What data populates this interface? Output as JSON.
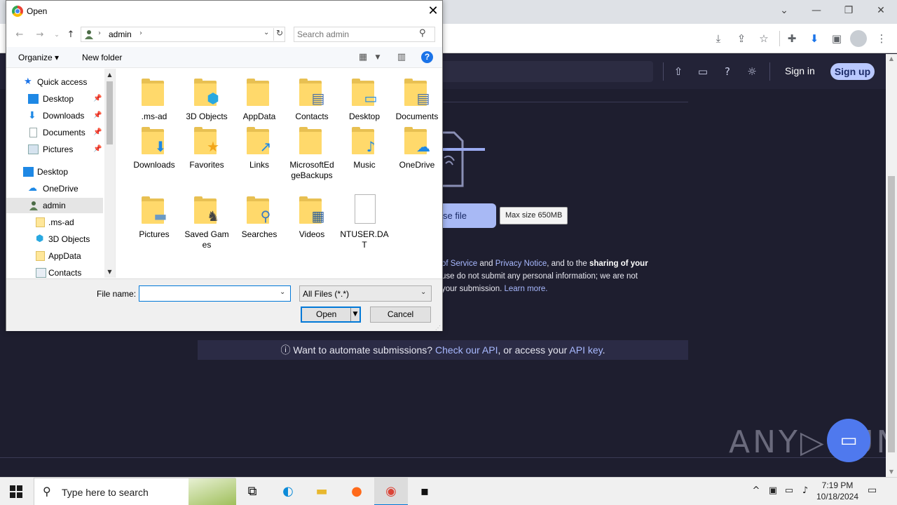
{
  "browser": {
    "window_controls": [
      "⌄",
      "—",
      "❐",
      "✕"
    ],
    "toolbar_icons": [
      "download-page-icon",
      "share-icon",
      "star-icon",
      "extensions-icon",
      "downloads-icon",
      "side-panel-icon",
      "profile-icon",
      "menu-icon"
    ]
  },
  "site": {
    "header": {
      "sign_in": "Sign in",
      "sign_up": "Sign up"
    },
    "upload": {
      "choose_file": "se file",
      "max_size": "Max size 650MB"
    },
    "terms": {
      "link1": "of Service",
      "and1": " and ",
      "link2": "Privacy Notice",
      "text1": ", and to the ",
      "bold1": "sharing of your",
      "line2": "use do not submit any personal information; we are not",
      "line3": "your submission. ",
      "link3": "Learn more."
    },
    "api": {
      "prefix": "Want to automate submissions? ",
      "link1": "Check our API",
      "middle": ", or access your ",
      "link2": "API key",
      "suffix": "."
    },
    "watermark": "ANY▷RUN"
  },
  "dialog": {
    "title": "Open",
    "breadcrumb": [
      "admin"
    ],
    "search_placeholder": "Search admin",
    "toolbar": {
      "organize": "Organize ▾",
      "new_folder": "New folder"
    },
    "nav": {
      "quick_access": "Quick access",
      "items": [
        {
          "label": "Desktop",
          "pinned": true
        },
        {
          "label": "Downloads",
          "pinned": true
        },
        {
          "label": "Documents",
          "pinned": true
        },
        {
          "label": "Pictures",
          "pinned": true
        }
      ],
      "desktop": "Desktop",
      "onedrive": "OneDrive",
      "admin": "admin",
      "sub": [
        ".ms-ad",
        "3D Objects",
        "AppData",
        "Contacts"
      ]
    },
    "files": [
      {
        "name": ".ms-ad",
        "kind": "folder",
        "overlay": ""
      },
      {
        "name": "3D Objects",
        "kind": "folder",
        "overlay": "⬢"
      },
      {
        "name": "AppData",
        "kind": "folder",
        "overlay": ""
      },
      {
        "name": "Contacts",
        "kind": "folder",
        "overlay": "▤"
      },
      {
        "name": "Desktop",
        "kind": "folder",
        "overlay": "▭"
      },
      {
        "name": "Documents",
        "kind": "folder",
        "overlay": "▤"
      },
      {
        "name": "Downloads",
        "kind": "folder",
        "overlay": "⬇"
      },
      {
        "name": "Favorites",
        "kind": "folder",
        "overlay": "★"
      },
      {
        "name": "Links",
        "kind": "folder",
        "overlay": "↗"
      },
      {
        "name": "MicrosoftEdgeBackups",
        "kind": "folder",
        "overlay": ""
      },
      {
        "name": "Music",
        "kind": "folder",
        "overlay": "♪"
      },
      {
        "name": "OneDrive",
        "kind": "folder",
        "overlay": "☁"
      },
      {
        "name": "Pictures",
        "kind": "folder",
        "overlay": "▬"
      },
      {
        "name": "Saved Games",
        "kind": "folder",
        "overlay": "♞"
      },
      {
        "name": "Searches",
        "kind": "folder",
        "overlay": "⚲"
      },
      {
        "name": "Videos",
        "kind": "folder",
        "overlay": "▦"
      },
      {
        "name": "NTUSER.DAT",
        "kind": "file",
        "overlay": ""
      }
    ],
    "file_name_label": "File name:",
    "file_name_value": "",
    "file_type": "All Files (*.*)",
    "open_label": "Open",
    "cancel_label": "Cancel"
  },
  "taskbar": {
    "search_placeholder": "Type here to search",
    "time": "7:19 PM",
    "date": "10/18/2024"
  },
  "colors": {
    "accent": "#0078d7",
    "site_bg": "#1e1e2f",
    "signup": "#b9c8ff",
    "folder": "#ffd96b"
  }
}
